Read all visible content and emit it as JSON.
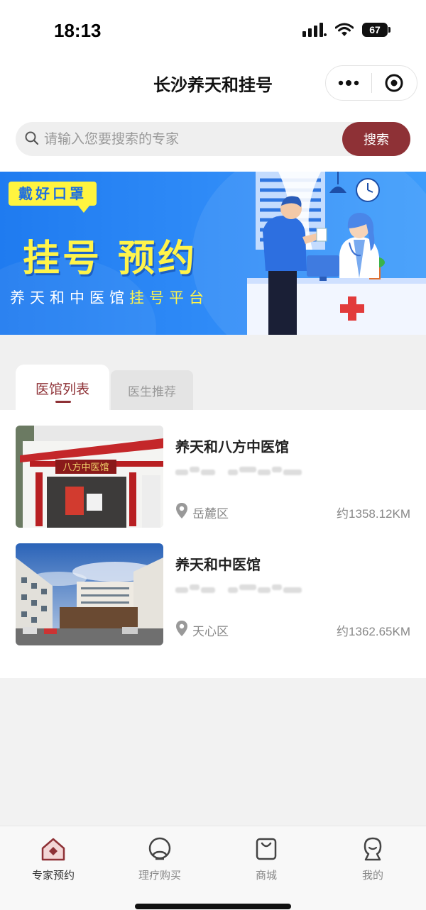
{
  "status_bar": {
    "time": "18:13",
    "battery": "67"
  },
  "nav": {
    "title": "长沙养天和挂号",
    "more_icon": "more-dots-icon",
    "close_icon": "target-circle-icon"
  },
  "search": {
    "placeholder": "请输入您要搜索的专家",
    "button_label": "搜索"
  },
  "banner": {
    "tag": "戴好口罩",
    "title": "挂号 预约",
    "subtitle_prefix": "养天和中医馆",
    "subtitle_highlight": "挂号平台"
  },
  "tabs": [
    {
      "label": "医馆列表",
      "active": true
    },
    {
      "label": "医生推荐",
      "active": false
    }
  ],
  "clinics": [
    {
      "name": "养天和八方中医馆",
      "district": "岳麓区",
      "distance": "约1358.12KM",
      "sign_text": "八方中医馆"
    },
    {
      "name": "养天和中医馆",
      "district": "天心区",
      "distance": "约1362.65KM"
    }
  ],
  "tabbar": [
    {
      "label": "专家预约",
      "icon": "home-icon",
      "active": true
    },
    {
      "label": "理疗购买",
      "icon": "therapy-icon",
      "active": false
    },
    {
      "label": "商城",
      "icon": "shopping-bag-icon",
      "active": false
    },
    {
      "label": "我的",
      "icon": "user-icon",
      "active": false
    }
  ],
  "colors": {
    "accent": "#8e3136",
    "banner_blue": "#2f8bf7",
    "banner_yellow": "#fff44a"
  }
}
